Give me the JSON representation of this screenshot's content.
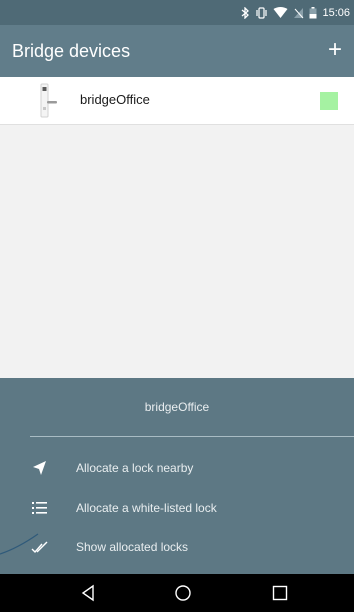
{
  "status_bar": {
    "time": "15:06",
    "icons": [
      "bluetooth-icon",
      "vibrate-icon",
      "wifi-icon",
      "no-sim-icon",
      "battery-icon"
    ]
  },
  "app_bar": {
    "title": "Bridge devices",
    "add_label": "+"
  },
  "devices": [
    {
      "name": "bridgeOffice",
      "icon": "door-lock-icon",
      "status_color": "#a5f2a2"
    }
  ],
  "bottom_sheet": {
    "title": "bridgeOffice",
    "items": [
      {
        "label": "Allocate a lock nearby",
        "icon": "navigation-arrow-icon"
      },
      {
        "label": "Allocate a white-listed lock",
        "icon": "list-icon"
      },
      {
        "label": "Show allocated locks",
        "icon": "double-check-icon"
      }
    ]
  },
  "nav_bar": {
    "buttons": [
      "back-icon",
      "home-icon",
      "recents-icon"
    ]
  },
  "colors": {
    "status_bar": "#4f6a76",
    "app_bar": "#617d8a",
    "sheet": "#5d7884",
    "status_ok": "#a5f2a2"
  }
}
